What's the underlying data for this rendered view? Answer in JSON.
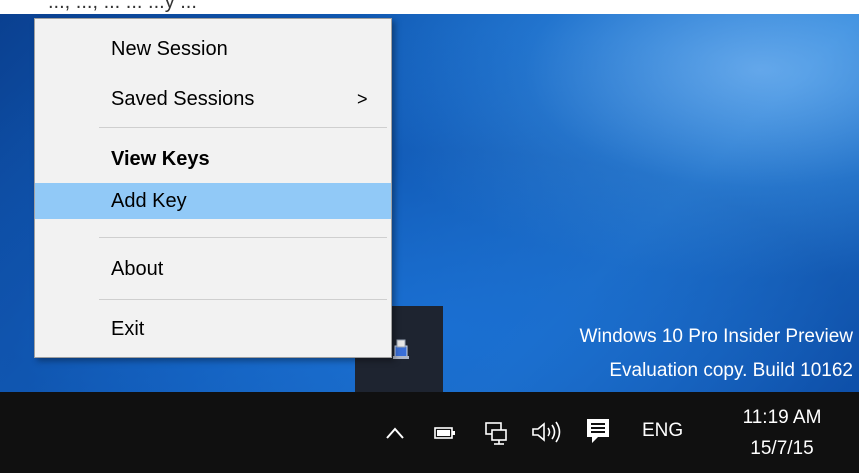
{
  "top_strip": {
    "partial_text": "..., ..., ... ... ...y ..."
  },
  "context_menu": {
    "items": [
      {
        "label": "New Session",
        "submenu_arrow": ""
      },
      {
        "label": "Saved Sessions",
        "submenu_arrow": ">"
      },
      {
        "label": "View Keys",
        "submenu_arrow": ""
      },
      {
        "label": "Add Key",
        "submenu_arrow": ""
      },
      {
        "label": "About",
        "submenu_arrow": ""
      },
      {
        "label": "Exit",
        "submenu_arrow": ""
      }
    ],
    "default_item": "View Keys",
    "highlighted_item": "Add Key",
    "highlight_color": "#91c9f7"
  },
  "desktop": {
    "watermark_line1": "Windows 10 Pro Insider Preview",
    "watermark_line2": "Evaluation copy. Build 10162"
  },
  "taskbar": {
    "icons": [
      "chevron-up-icon",
      "battery-icon",
      "network-icon",
      "volume-icon",
      "action-center-icon"
    ],
    "language": "ENG",
    "time": "11:19 AM",
    "date": "15/7/15"
  }
}
